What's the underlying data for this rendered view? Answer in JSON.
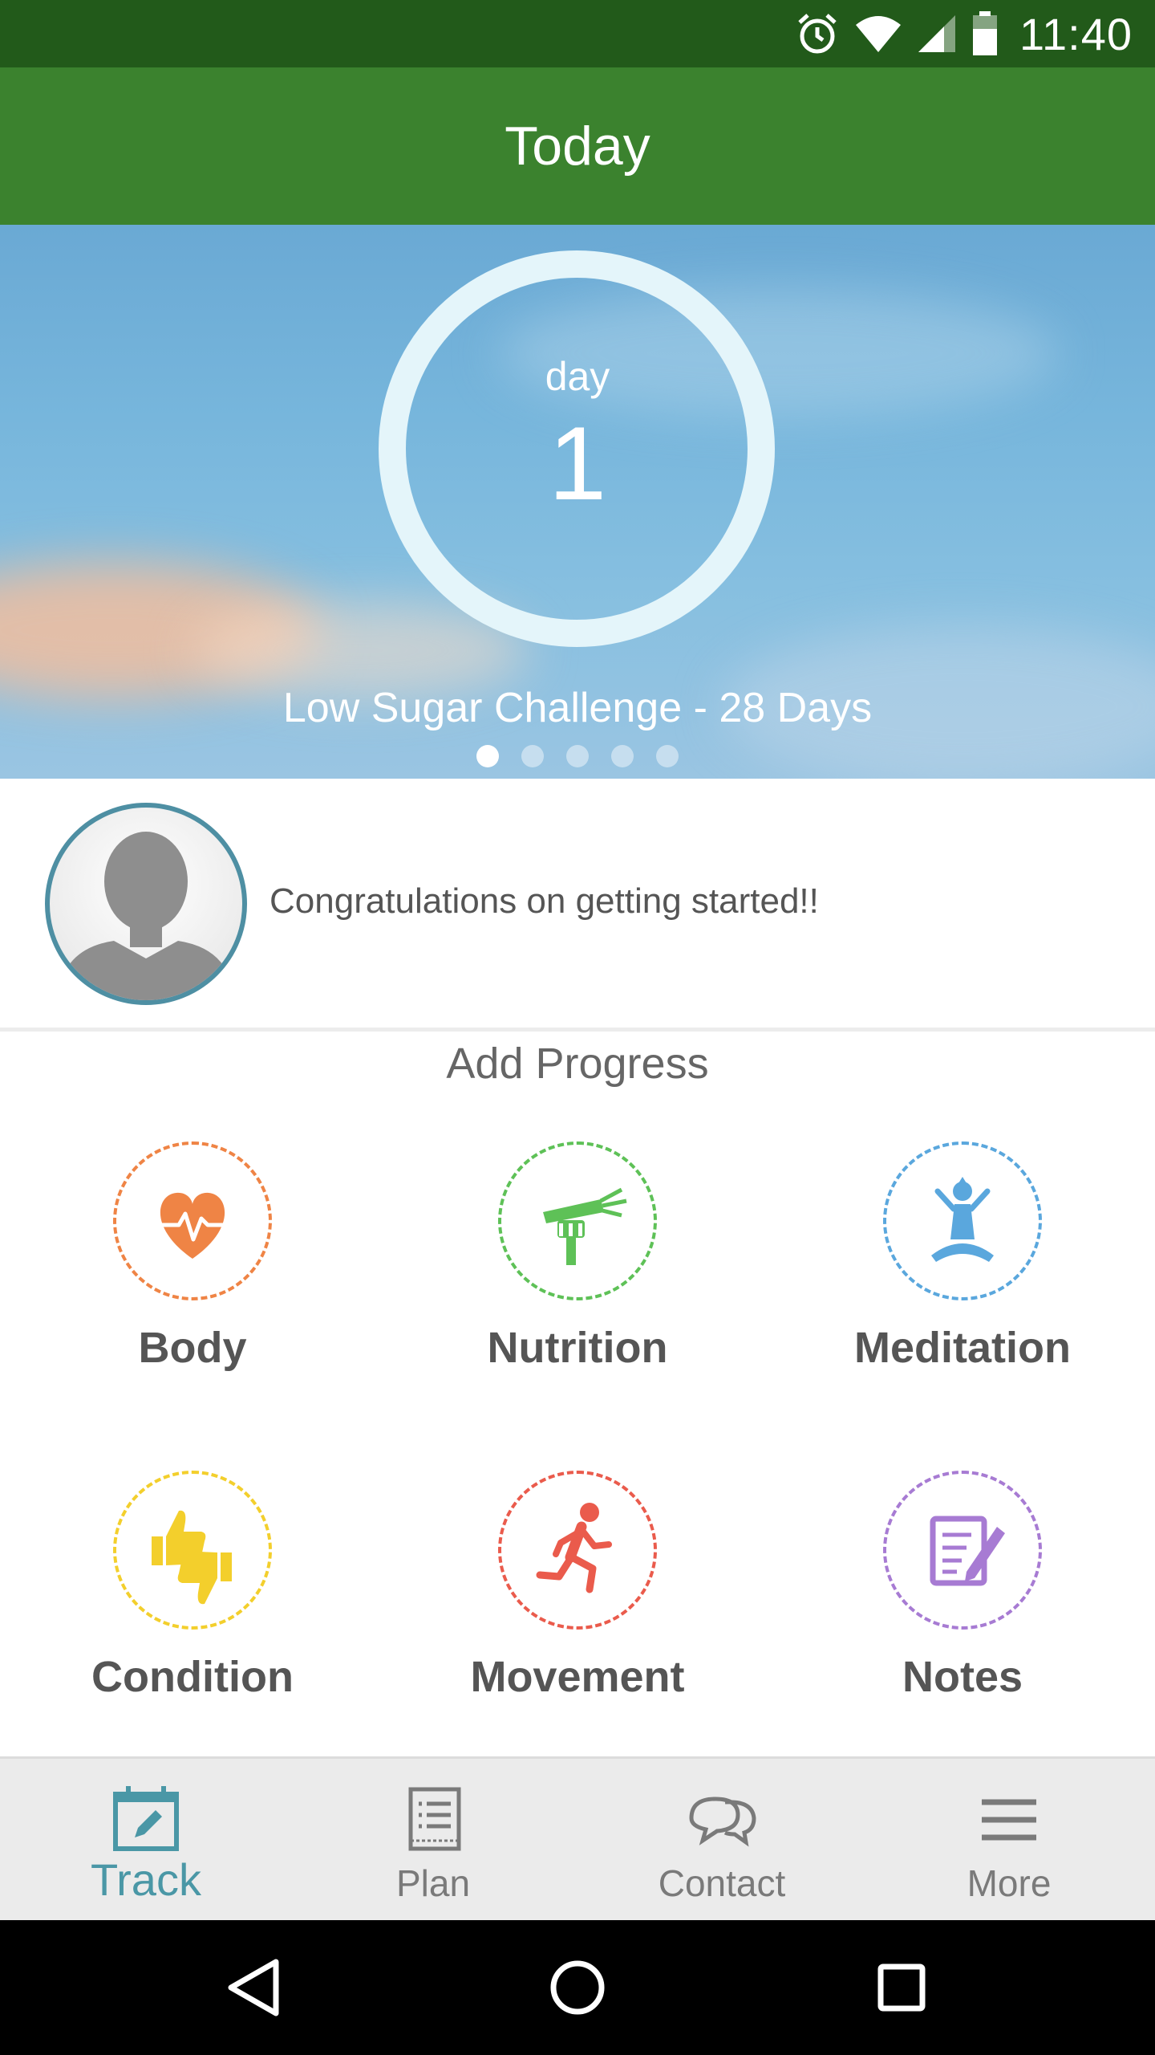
{
  "status_bar": {
    "time": "11:40",
    "icons": [
      "alarm-icon",
      "wifi-icon",
      "cell-signal-icon",
      "battery-icon"
    ]
  },
  "app_bar": {
    "title": "Today"
  },
  "hero": {
    "day_label": "day",
    "day_number": "1",
    "challenge_title": "Low Sugar Challenge - 28 Days",
    "pages": 5,
    "active_page": 1,
    "ring_color": "#e4f5fa"
  },
  "message": {
    "text": "Congratulations on getting started!!",
    "avatar_border_color": "#4e8fa3"
  },
  "progress": {
    "title": "Add Progress",
    "tiles": [
      {
        "label": "Body",
        "icon": "heart-pulse-icon",
        "color": "#ef8445"
      },
      {
        "label": "Nutrition",
        "icon": "fork-carrot-icon",
        "color": "#5ec157"
      },
      {
        "label": "Meditation",
        "icon": "meditation-icon",
        "color": "#5aa7dd"
      },
      {
        "label": "Condition",
        "icon": "thumbs-up-down-icon",
        "color": "#f3cf2c"
      },
      {
        "label": "Movement",
        "icon": "running-icon",
        "color": "#ea5b4c"
      },
      {
        "label": "Notes",
        "icon": "notes-icon",
        "color": "#a77bd3"
      }
    ]
  },
  "bottom_nav": {
    "active": "Track",
    "accent_color": "#4a97a6",
    "items": [
      {
        "label": "Track",
        "icon": "calendar-edit-icon"
      },
      {
        "label": "Plan",
        "icon": "list-document-icon"
      },
      {
        "label": "Contact",
        "icon": "chat-bubbles-icon"
      },
      {
        "label": "More",
        "icon": "hamburger-menu-icon"
      }
    ]
  },
  "system_nav": {
    "buttons": [
      "back-icon",
      "home-icon",
      "recents-icon"
    ]
  }
}
